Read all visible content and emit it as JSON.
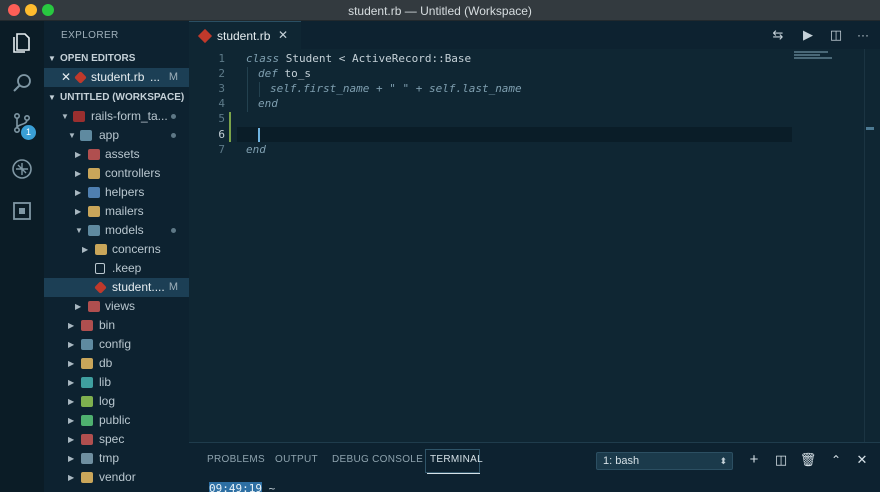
{
  "window": {
    "title": "student.rb — Untitled (Workspace)"
  },
  "activity_bar": {
    "scm_badge": "1"
  },
  "sidebar": {
    "title": "EXPLORER",
    "open_editors_label": "OPEN EDITORS",
    "open_editor": {
      "name": "student.rb",
      "ellipsis": "...",
      "status": "M"
    },
    "workspace_label": "UNTITLED (WORKSPACE)",
    "tree": [
      {
        "label": "rails-form_ta...",
        "dot": true
      },
      {
        "label": "app",
        "dot": true
      },
      {
        "label": "assets"
      },
      {
        "label": "controllers"
      },
      {
        "label": "helpers"
      },
      {
        "label": "mailers"
      },
      {
        "label": "models",
        "dot": true
      },
      {
        "label": "concerns"
      },
      {
        "label": ".keep"
      },
      {
        "label": "student....",
        "status": "M"
      },
      {
        "label": "views"
      },
      {
        "label": "bin"
      },
      {
        "label": "config"
      },
      {
        "label": "db"
      },
      {
        "label": "lib"
      },
      {
        "label": "log"
      },
      {
        "label": "public"
      },
      {
        "label": "spec"
      },
      {
        "label": "tmp"
      },
      {
        "label": "vendor"
      }
    ]
  },
  "editor": {
    "tab_label": "student.rb",
    "line_numbers": [
      "1",
      "2",
      "3",
      "4",
      "5",
      "6",
      "7"
    ],
    "lines": {
      "l1_kw": "class",
      "l1_rest": " Student < ActiveRecord::Base",
      "l2_kw": "def",
      "l2_rest": " to_s",
      "l3_a": "self",
      "l3_b": ".first_name + \" \" + ",
      "l3_c": "self",
      "l3_d": ".last_name",
      "l4_kw": "end",
      "l7_kw": "end"
    }
  },
  "panel": {
    "tabs": [
      "PROBLEMS",
      "OUTPUT",
      "DEBUG CONSOLE",
      "TERMINAL"
    ],
    "terminal_select": "1: bash",
    "terminal_time": "09:49:19",
    "terminal_prompt": " ~"
  }
}
